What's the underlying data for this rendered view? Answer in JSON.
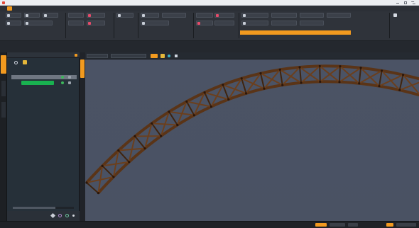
{
  "app": {
    "title": "",
    "accent_color": "#f29a1f"
  },
  "titlebar": {
    "title": ""
  },
  "menubar": {
    "items": [
      "",
      "",
      "",
      "",
      ""
    ]
  },
  "ribbon": {
    "groups": [
      "",
      "",
      "",
      "",
      "",
      "",
      ""
    ]
  },
  "left_panel": {
    "header": "",
    "tree": {
      "root": "",
      "row1": "",
      "row2": ""
    },
    "bottom": {
      "value": ""
    }
  },
  "viewport": {
    "toolbar": {
      "view_mode": "",
      "quality": ""
    }
  },
  "status": {
    "left": "",
    "right": ""
  }
}
